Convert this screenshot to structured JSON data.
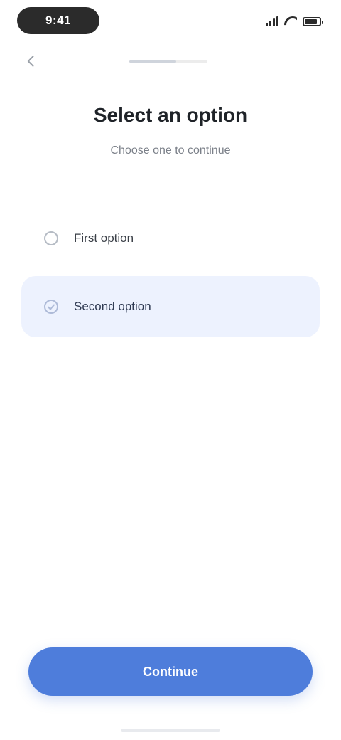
{
  "status_bar": {
    "time": "9:41"
  },
  "nav": {
    "back_icon": "chevron-left-icon",
    "progress": 0.6,
    "step_label": ""
  },
  "header": {
    "title": "Select an option",
    "subtitle": "Choose one to continue"
  },
  "options": [
    {
      "label": "First option",
      "icon": "circle-icon",
      "selected": false
    },
    {
      "label": "Second option",
      "icon": "check-circle-icon",
      "selected": true
    }
  ],
  "primary_button": {
    "label": "Continue"
  },
  "colors": {
    "accent": "#4e7ddb",
    "selected_bg": "#edf2fe",
    "text": "#1f2328",
    "muted": "#7b8089"
  }
}
